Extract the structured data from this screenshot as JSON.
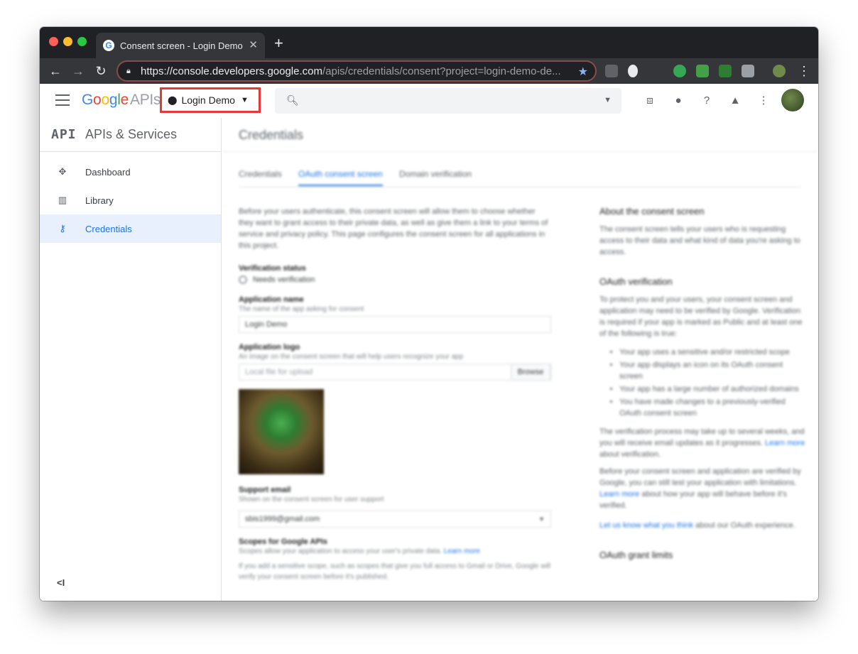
{
  "browser": {
    "tab_title": "Consent screen - Login Demo",
    "tab_favicon": "G",
    "url_host": "https://console.developers.google.com",
    "url_path": "/apis/credentials/consent?project=login-demo-de..."
  },
  "header": {
    "logo_google": "Google",
    "logo_apis": "APIs",
    "project_name": "Login Demo"
  },
  "sidebar": {
    "title_icon": "API",
    "title": "APIs & Services",
    "items": [
      {
        "label": "Dashboard",
        "icon": "dashboard-icon"
      },
      {
        "label": "Library",
        "icon": "library-icon"
      },
      {
        "label": "Credentials",
        "icon": "key-icon",
        "active": true
      }
    ],
    "collapse": "<I"
  },
  "main": {
    "title": "Credentials",
    "tabs": [
      "Credentials",
      "OAuth consent screen",
      "Domain verification"
    ],
    "active_tab": 1,
    "intro": "Before your users authenticate, this consent screen will allow them to choose whether they want to grant access to their private data, as well as give them a link to your terms of service and privacy policy. This page configures the consent screen for all applications in this project.",
    "verification_label": "Verification status",
    "verification_value": "Needs verification",
    "app_name_label": "Application name",
    "app_name_help": "The name of the app asking for consent",
    "app_name_value": "Login Demo",
    "app_logo_label": "Application logo",
    "app_logo_help": "An image on the consent screen that will help users recognize your app",
    "app_logo_placeholder": "Local file for upload",
    "browse_label": "Browse",
    "support_email_label": "Support email",
    "support_email_help": "Shown on the consent screen for user support",
    "support_email_value": "sbis1999@gmail.com",
    "scopes_label": "Scopes for Google APIs",
    "scopes_help": "Scopes allow your application to access your user's private data.",
    "scopes_learn_more": "Learn more",
    "scopes_note": "If you add a sensitive scope, such as scopes that give you full access to Gmail or Drive, Google will verify your consent screen before it's published."
  },
  "aside": {
    "about_title": "About the consent screen",
    "about_text": "The consent screen tells your users who is requesting access to their data and what kind of data you're asking to access.",
    "oauth_title": "OAuth verification",
    "oauth_text": "To protect you and your users, your consent screen and application may need to be verified by Google. Verification is required if your app is marked as Public and at least one of the following is true:",
    "bullets": [
      "Your app uses a sensitive and/or restricted scope",
      "Your app displays an icon on its OAuth consent screen",
      "Your app has a large number of authorized domains",
      "You have made changes to a previously-verified OAuth consent screen"
    ],
    "process_text": "The verification process may take up to several weeks, and you will receive email updates as it progresses.",
    "process_link": "Learn more",
    "process_tail": "about verification.",
    "before_text": "Before your consent screen and application are verified by Google, you can still test your application with limitations.",
    "before_link": "Learn more",
    "before_tail": "about how your app will behave before it's verified.",
    "feedback_link": "Let us know what you think",
    "feedback_tail": "about our OAuth experience.",
    "limits_title": "OAuth grant limits"
  },
  "colors": {
    "accent": "#1a73e8",
    "highlight_border": "#e53935"
  }
}
